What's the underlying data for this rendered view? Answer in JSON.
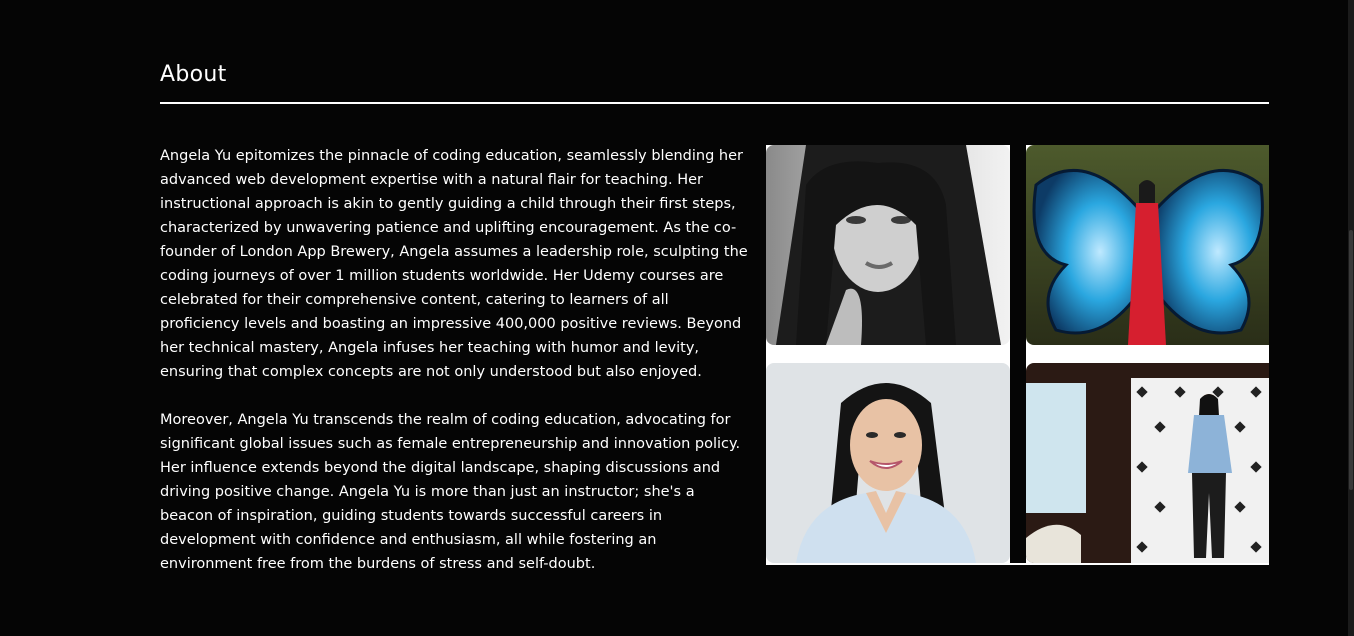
{
  "about": {
    "title": "About",
    "paragraphs": [
      "Angela Yu epitomizes the pinnacle of coding education, seamlessly blending her advanced web development expertise with a natural flair for teaching. Her instructional approach is akin to gently guiding a child through their first steps, characterized by unwavering patience and uplifting encouragement. As the co-founder of London App Brewery, Angela assumes a leadership role, sculpting the coding journeys of over 1 million students worldwide. Her Udemy courses are celebrated for their comprehensive content, catering to learners of all proficiency levels and boasting an impressive 400,000 positive reviews. Beyond her technical mastery, Angela infuses her teaching with humor and levity, ensuring that complex concepts are not only understood but also enjoyed.",
      "Moreover, Angela Yu transcends the realm of coding education, advocating for significant global issues such as female entrepreneurship and innovation policy. Her influence extends beyond the digital landscape, shaping discussions and driving positive change. Angela Yu is more than just an instructor; she's a beacon of inspiration, guiding students towards successful careers in development with confidence and enthusiasm, all while fostering an environment free from the burdens of stress and self-doubt."
    ]
  },
  "gallery": {
    "photos": [
      {
        "subject": "black-and-white-portrait"
      },
      {
        "subject": "butterfly-wings-mural"
      },
      {
        "subject": "smiling-headshot"
      },
      {
        "subject": "speaking-on-stage"
      }
    ]
  },
  "colors": {
    "background": "#050505",
    "text": "#ffffff",
    "wing_blue": "#2aa7e0",
    "dress_red": "#d61f2f"
  }
}
